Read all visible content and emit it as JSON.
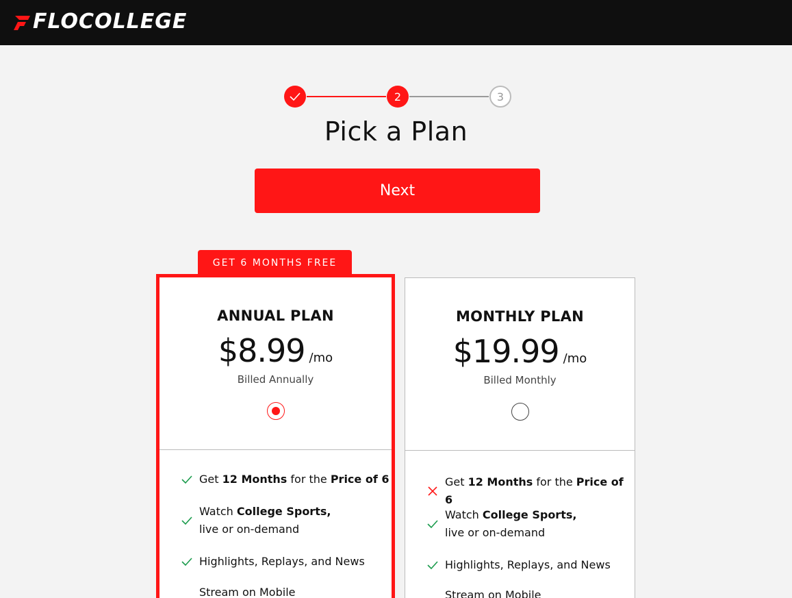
{
  "brand": {
    "part1": "FLO",
    "part2": "COLLEGE",
    "accent": "#ff1616"
  },
  "stepper": {
    "steps": [
      {
        "state": "done",
        "label": ""
      },
      {
        "state": "current",
        "label": "2"
      },
      {
        "state": "todo",
        "label": "3"
      }
    ]
  },
  "title": "Pick a Plan",
  "next_label": "Next",
  "promo": "GET 6 MONTHS FREE",
  "plans": [
    {
      "name": "ANNUAL PLAN",
      "price": "$8.99",
      "per": "/mo",
      "billed": "Billed Annually",
      "selected": true,
      "features": [
        {
          "icon": "check-icon",
          "pre": "Get ",
          "b1": "12 Months",
          "mid": " for the ",
          "b2": "Price of 6"
        },
        {
          "icon": "check-icon",
          "pre": "Watch ",
          "b1": "College Sports,",
          "line2": "live or on-demand"
        },
        {
          "icon": "check-icon",
          "text": "Highlights, Replays, and News"
        },
        {
          "icon": "check-icon",
          "text": "Stream on Mobile"
        }
      ]
    },
    {
      "name": "MONTHLY PLAN",
      "price": "$19.99",
      "per": "/mo",
      "billed": "Billed Monthly",
      "selected": false,
      "features": [
        {
          "icon": "x-icon",
          "pre": "Get ",
          "b1": "12 Months",
          "mid": " for the ",
          "b2": "Price of 6"
        },
        {
          "icon": "check-icon",
          "pre": "Watch ",
          "b1": "College Sports,",
          "line2": "live or on-demand"
        },
        {
          "icon": "check-icon",
          "text": "Highlights, Replays, and News"
        },
        {
          "icon": "check-icon",
          "text": "Stream on Mobile"
        }
      ]
    }
  ]
}
